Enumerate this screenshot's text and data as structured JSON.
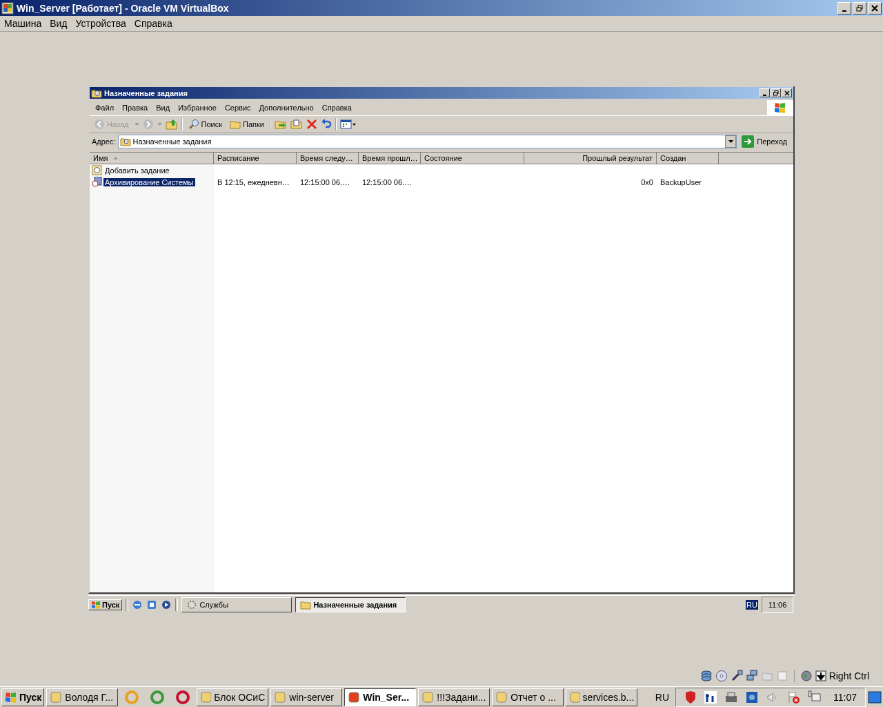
{
  "host_window": {
    "title": "Win_Server [Работает] - Oracle VM VirtualBox",
    "menu": [
      "Машина",
      "Вид",
      "Устройства",
      "Справка"
    ]
  },
  "guest_window": {
    "title": "Назначенные задания",
    "menu": [
      "Файл",
      "Правка",
      "Вид",
      "Избранное",
      "Сервис",
      "Дополнительно",
      "Справка"
    ],
    "toolbar": {
      "back": "Назад",
      "search": "Поиск",
      "folders": "Папки"
    },
    "address": {
      "label": "Адрес:",
      "value": "Назначенные задания",
      "go": "Переход"
    },
    "table": {
      "columns": [
        {
          "label": "Имя",
          "sorted": true,
          "kind": "text"
        },
        {
          "label": "Расписание",
          "kind": "text"
        },
        {
          "label": "Время следу…",
          "kind": "text"
        },
        {
          "label": "Время прошл…",
          "kind": "text"
        },
        {
          "label": "Состояние",
          "kind": "text"
        },
        {
          "label": "Прошлый результат",
          "kind": "number"
        },
        {
          "label": "Создан",
          "kind": "text"
        }
      ],
      "rows": [
        {
          "kind": "add",
          "cells": [
            "Добавить задание"
          ],
          "selected": false
        },
        {
          "kind": "task",
          "cells": [
            "Архивирование Системы",
            "В 12:15, ежедневн…",
            "12:15:00  06.…",
            "12:15:00  06.…",
            "",
            "0x0",
            "BackupUser"
          ],
          "selected": true
        }
      ]
    }
  },
  "guest_taskbar": {
    "start": "Пуск",
    "tasks": [
      {
        "label": "Службы",
        "selected": false
      },
      {
        "label": "Назначенные задания",
        "selected": true
      }
    ],
    "language": "RU",
    "clock": "11:06"
  },
  "vm_status": {
    "host_key": "Right Ctrl"
  },
  "host_taskbar": {
    "start": "Пуск",
    "items": [
      {
        "kind": "task",
        "label": "Володя Г...",
        "selected": false
      },
      {
        "kind": "launcher"
      },
      {
        "kind": "launcher"
      },
      {
        "kind": "launcher"
      },
      {
        "kind": "task",
        "label": "Блок ОСиС",
        "selected": false
      },
      {
        "kind": "task",
        "label": "win-server",
        "selected": false
      },
      {
        "kind": "task",
        "label": "Win_Ser...",
        "selected": true
      },
      {
        "kind": "task",
        "label": "!!!Задани...",
        "selected": false
      },
      {
        "kind": "task",
        "label": "Отчет о ...",
        "selected": false
      },
      {
        "kind": "task",
        "label": "services.b...",
        "selected": false
      }
    ],
    "language": "RU",
    "clock": "11:07"
  }
}
